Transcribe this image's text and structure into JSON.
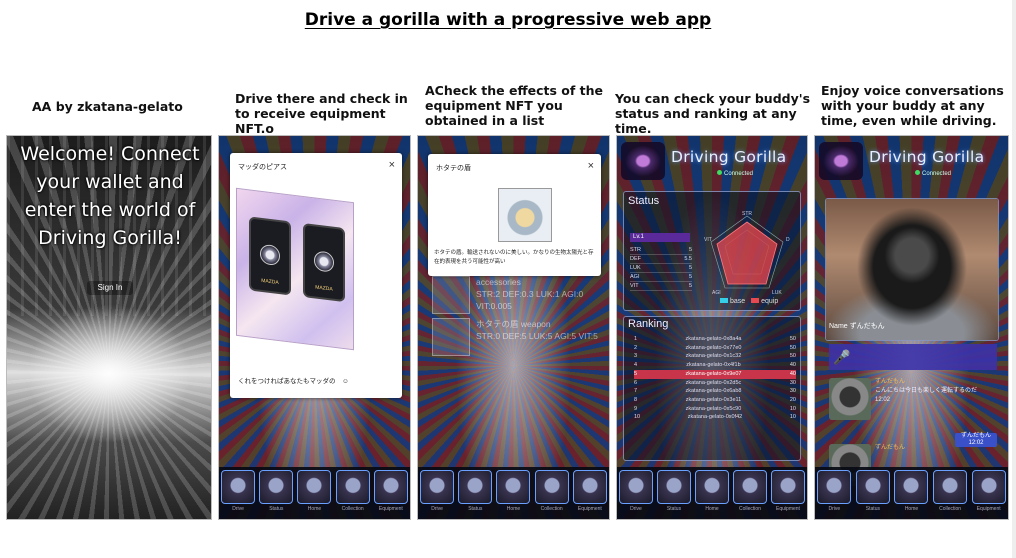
{
  "page": {
    "title": "Drive a gorilla with a progressive web app"
  },
  "captions": [
    "AA by zkatana-gelato",
    "Drive there and check in to receive equipment NFT.o",
    "ACheck the effects of the equipment NFT you obtained in a list",
    "You can check your buddy's status and ranking at any time.",
    "Enjoy voice conversations with your buddy at any time, even while driving."
  ],
  "screen1": {
    "welcome": "Welcome! Connect your wallet and enter the world of Driving Gorilla!",
    "signin": "Sign In"
  },
  "nav": {
    "labels": [
      "Drive",
      "Status",
      "Home",
      "Collection",
      "Equipment"
    ]
  },
  "screen2": {
    "modal_title": "マッダのピアス",
    "close": "×",
    "footer": "くれをつけれぱあなたもマッダの　☺"
  },
  "screen3": {
    "modal_title": "ホタテの盾",
    "close": "×",
    "description": "ホタテの盾。輸送されないのに美しい。かなりの生物太陽光と存在的表現を共う可能性が高い",
    "items": [
      {
        "category": "accessories",
        "stats": "STR:2 DEF:0.3 LUK:1 AGI:0 VIT:0.005"
      },
      {
        "category": "ホタテの盾 weapon",
        "stats": "STR:0 DEF:5 LUK:5 AGI:5 VIT:5"
      }
    ]
  },
  "app": {
    "title": "Driving Gorilla",
    "connection": "Connected"
  },
  "screen4": {
    "status_heading": "Status",
    "status_chip": "Lv.1",
    "stats": [
      {
        "name": "STR",
        "value": "5"
      },
      {
        "name": "DEF",
        "value": "5.5"
      },
      {
        "name": "LUK",
        "value": "5"
      },
      {
        "name": "AGI",
        "value": "5"
      },
      {
        "name": "VIT",
        "value": "5"
      }
    ],
    "legend": {
      "base": "base",
      "equip": "equip",
      "base_color": "#35d0e8",
      "equip_color": "#e84850"
    },
    "ranking_heading": "Ranking",
    "ranking": [
      {
        "rank": "1",
        "name": "zkatana-gelato-0x8a4a",
        "score": "50"
      },
      {
        "rank": "2",
        "name": "zkatana-gelato-0x77e0",
        "score": "50"
      },
      {
        "rank": "3",
        "name": "zkatana-gelato-0x1c32",
        "score": "50"
      },
      {
        "rank": "4",
        "name": "zkatana-gelato-0x4f1b",
        "score": "40"
      },
      {
        "rank": "5",
        "name": "zkatana-gelato-0x9e07",
        "score": "40"
      },
      {
        "rank": "6",
        "name": "zkatana-gelato-0x2d5c",
        "score": "30"
      },
      {
        "rank": "7",
        "name": "zkatana-gelato-0x6ab8",
        "score": "30"
      },
      {
        "rank": "8",
        "name": "zkatana-gelato-0x3e11",
        "score": "20"
      },
      {
        "rank": "9",
        "name": "zkatana-gelato-0x5c90",
        "score": "10"
      },
      {
        "rank": "10",
        "name": "zkatana-gelato-0x0f42",
        "score": "10"
      }
    ]
  },
  "screen5": {
    "buddy_name": "Name ずんだもん",
    "mic": "🎤",
    "messages": [
      {
        "name": "ずんだもん",
        "text": "こんにちは今日も楽しく運転するのだ",
        "time": "12:02"
      },
      {
        "name": "ずんだもん",
        "text": "",
        "time": ""
      }
    ],
    "reply": "ずんだもん 12:02"
  }
}
